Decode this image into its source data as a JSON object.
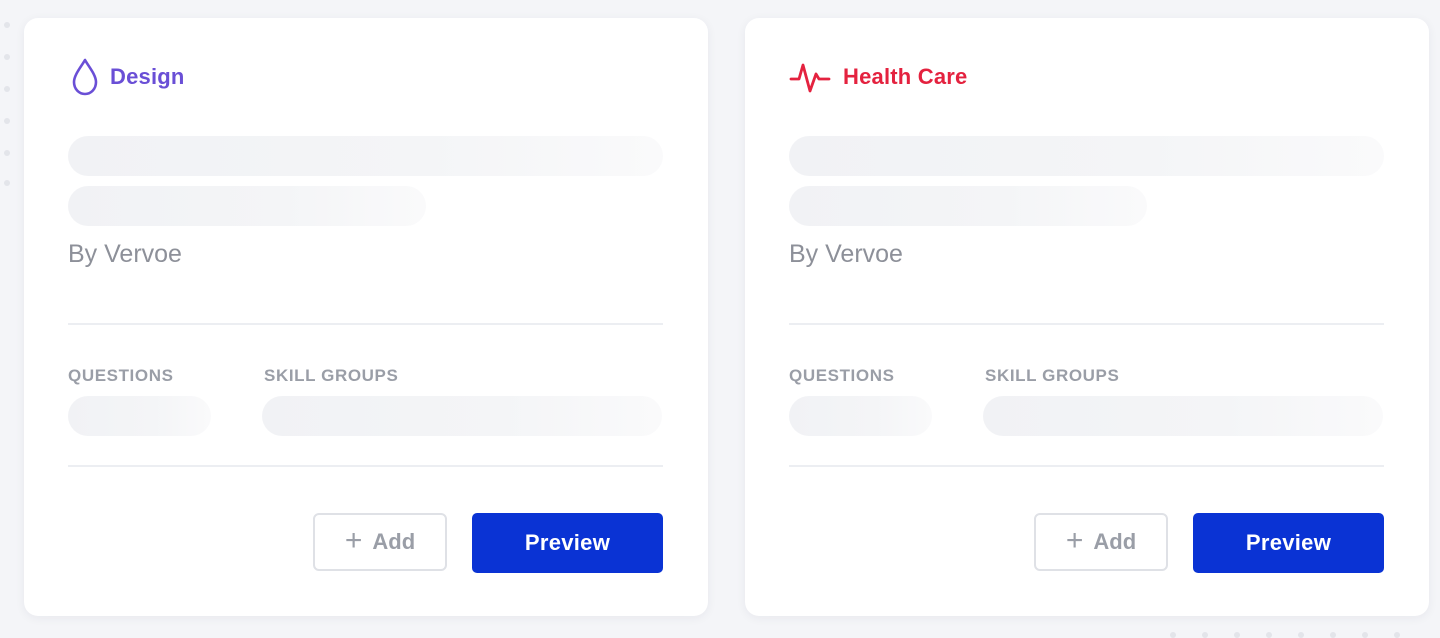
{
  "cards": [
    {
      "category": {
        "label": "Design",
        "icon": "drop-icon",
        "color": "#6a4fd6"
      },
      "author": "By Vervoe",
      "questions_label": "QUESTIONS",
      "skill_groups_label": "SKILL GROUPS",
      "add_label": "Add",
      "preview_label": "Preview"
    },
    {
      "category": {
        "label": "Health Care",
        "icon": "heartbeat-icon",
        "color": "#e4223f"
      },
      "author": "By Vervoe",
      "questions_label": "QUESTIONS",
      "skill_groups_label": "SKILL GROUPS",
      "add_label": "Add",
      "preview_label": "Preview"
    }
  ],
  "theme": {
    "primary_button": "#0a33d4",
    "page_background": "#f4f5f8"
  }
}
